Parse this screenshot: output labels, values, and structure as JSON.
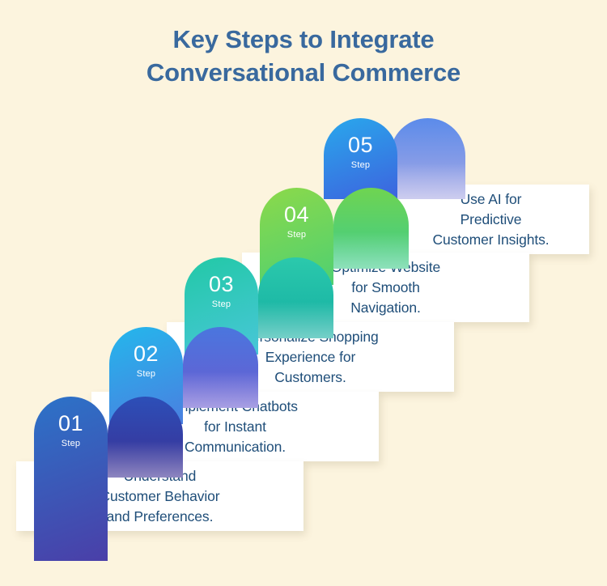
{
  "background_color": "#FCF4DE",
  "title": {
    "text": "Key Steps to Integrate\nConversational Commerce",
    "color": "#39699E"
  },
  "step_label": "Step",
  "text_color": "#1F4E79",
  "steps": [
    {
      "number": "01",
      "label": "Step",
      "text": "Understand\nCustomer Behavior\nand Preferences.",
      "front_color_top": "#2C73C8",
      "front_color_bottom": "#4A3FA8",
      "back_color_top": "#2C4FB8",
      "back_color_bottom": "#3C2F93"
    },
    {
      "number": "02",
      "label": "Step",
      "text": "Implement Chatbots\nfor Instant\nCommunication.",
      "front_color_top": "#24B7EC",
      "front_color_bottom": "#4A7FE0",
      "back_color_top": "#4A76DE",
      "back_color_bottom": "#6A5BD0"
    },
    {
      "number": "03",
      "label": "Step",
      "text": "Personalize Shopping\nExperience for\nCustomers.",
      "front_color_top": "#22C9A6",
      "front_color_bottom": "#48C6D8",
      "back_color_top": "#2BC9AC",
      "back_color_bottom": "#14AEA2"
    },
    {
      "number": "04",
      "label": "Step",
      "text": "Optimize Website\nfor Smooth\nNavigation.",
      "front_color_top": "#8CD94A",
      "front_color_bottom": "#4FD071",
      "back_color_top": "#6FD451",
      "back_color_bottom": "#3ECB8B"
    },
    {
      "number": "05",
      "label": "Step",
      "text": "Use AI for\nPredictive\nCustomer Insights.",
      "front_color_top": "#29A8EC",
      "front_color_bottom": "#3D63DE",
      "back_color_top": "#5B8BEA",
      "back_color_bottom": "#A9A9E4"
    }
  ]
}
